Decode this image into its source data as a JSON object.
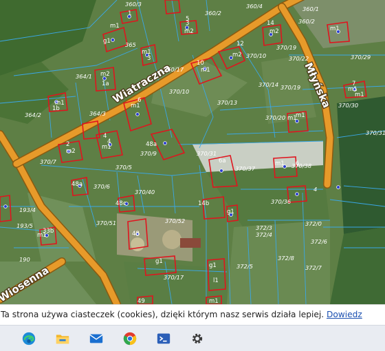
{
  "map": {
    "streets": [
      {
        "name": "Wiatraczna"
      },
      {
        "name": "Młyńska"
      },
      {
        "name": "Wiosenna"
      }
    ],
    "building_labels": [
      "m1",
      "g1",
      "1",
      "m1",
      "3",
      "12",
      "m2",
      "m1",
      "14",
      "m2",
      "3",
      "m2",
      "m2",
      "1a",
      "10",
      "m1",
      "m1",
      "7",
      "m1",
      "5",
      "m1",
      "6",
      "4",
      "m1",
      "1b",
      "m1",
      "2",
      "m2",
      "4",
      "48a",
      "6",
      "m1",
      "m1",
      "m1",
      "6a",
      "48a",
      "48c",
      "33b",
      "m1",
      "14b",
      "g1",
      "48",
      "g1",
      "g1",
      "l1",
      "49",
      "m1"
    ],
    "parcel_labels": [
      "360/3",
      "360/2",
      "360/4",
      "360/1",
      "365",
      "360/17",
      "360/2",
      "370/22",
      "370/10",
      "370/19",
      "370/29",
      "364/1",
      "370/10",
      "370/14",
      "370/19",
      "364/2",
      "364/3",
      "370/13",
      "370/30",
      "370/20",
      "370/31",
      "370/7",
      "370/5",
      "370/37",
      "370/38",
      "370/6",
      "370/9",
      "370/40",
      "193/4",
      "370/51",
      "370/52",
      "193/5",
      "372/3",
      "372/4",
      "372/0",
      "372/6",
      "370/36",
      "372/5",
      "372/8",
      "372/7",
      "370/17",
      "190",
      "370/31",
      "4"
    ]
  },
  "cookie": {
    "text": "Ta strona używa ciasteczek (cookies), dzięki którym nasz serwis działa lepiej.",
    "link": "Dowiedz"
  },
  "taskbar": {
    "apps": [
      {
        "name": "edge-browser-icon"
      },
      {
        "name": "file-explorer-icon"
      },
      {
        "name": "mail-icon"
      },
      {
        "name": "chrome-icon"
      },
      {
        "name": "powershell-icon"
      },
      {
        "name": "settings-gear-icon"
      }
    ]
  }
}
